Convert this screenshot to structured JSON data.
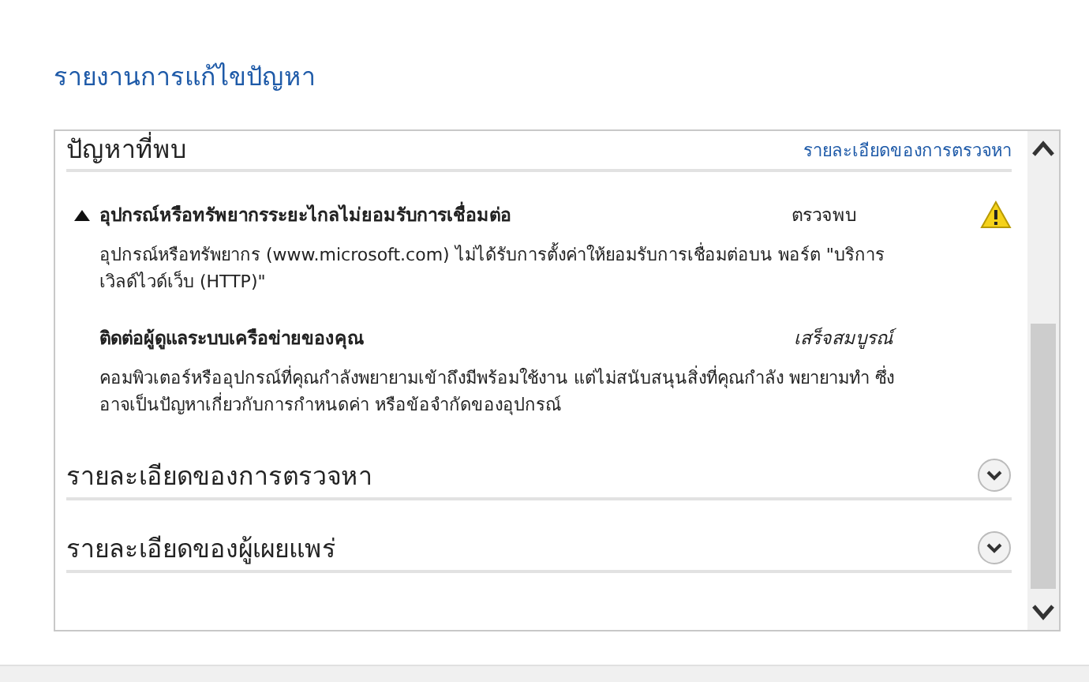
{
  "page_title": "รายงานการแก้ไขปัญหา",
  "problems": {
    "heading": "ปัญหาที่พบ",
    "link": "รายละเอียดของการตรวจหา",
    "items": [
      {
        "kind": "problem",
        "title": "อุปกรณ์หรือทรัพยากรระยะไกลไม่ยอมรับการเชื่อมต่อ",
        "status": "ตรวจพบ",
        "description": "อุปกรณ์หรือทรัพยากร (www.microsoft.com) ไม่ได้รับการตั้งค่าให้ยอมรับการเชื่อมต่อบน พอร์ต \"บริการเวิลด์ไวด์เว็บ (HTTP)\""
      },
      {
        "kind": "cause",
        "title": "ติดต่อผู้ดูแลระบบเครือข่ายของคุณ",
        "status": "เสร็จสมบูรณ์",
        "description": "คอมพิวเตอร์หรืออุปกรณ์ที่คุณกำลังพยายามเข้าถึงมีพร้อมใช้งาน แต่ไม่สนับสนุนสิ่งที่คุณกำลัง พยายามทำ ซึ่งอาจเป็นปัญหาเกี่ยวกับการกำหนดค่า หรือข้อจำกัดของอุปกรณ์"
      }
    ]
  },
  "sections": [
    {
      "title": "รายละเอียดของการตรวจหา",
      "expanded": false
    },
    {
      "title": "รายละเอียดของผู้เผยแพร่",
      "expanded": false
    }
  ]
}
